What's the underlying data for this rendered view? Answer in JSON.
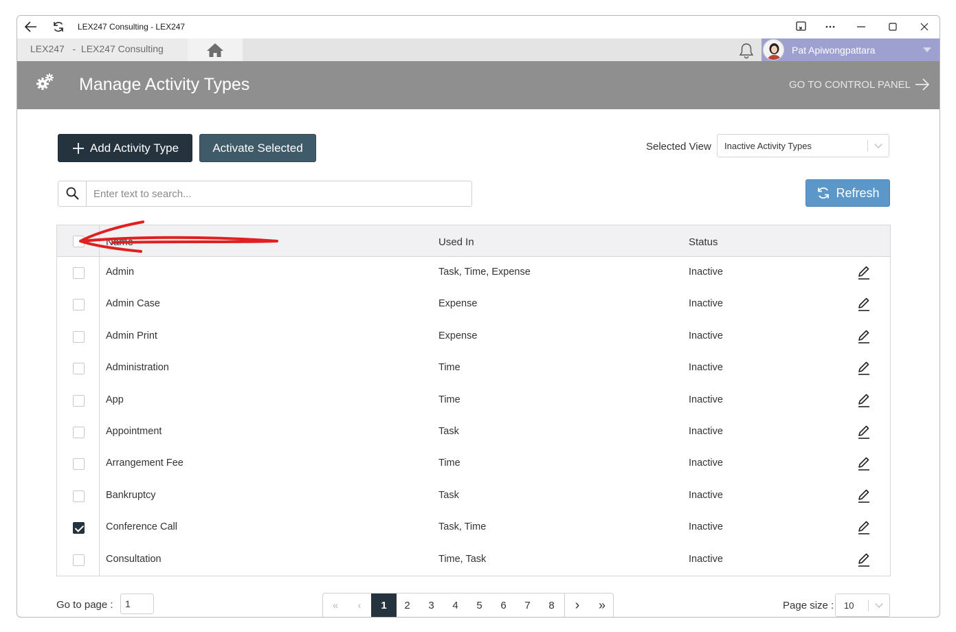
{
  "window": {
    "title": "LEX247 Consulting - LEX247"
  },
  "tabs": {
    "main_label": "LEX247   -  LEX247 Consulting",
    "home_icon": "home-icon"
  },
  "user": {
    "name": "Pat Apiwongpattara"
  },
  "header": {
    "title": "Manage Activity Types",
    "control_panel_label": "GO TO CONTROL PANEL"
  },
  "toolbar": {
    "add_label": "Add Activity Type",
    "activate_label": "Activate Selected",
    "selected_view_label": "Selected View",
    "selected_view_value": "Inactive Activity Types",
    "refresh_label": "Refresh"
  },
  "search": {
    "placeholder": "Enter text to search..."
  },
  "grid": {
    "columns": [
      "Name",
      "Used In",
      "Status"
    ],
    "rows": [
      {
        "name": "Admin",
        "used_in": "Task, Time, Expense",
        "status": "Inactive",
        "checked": false
      },
      {
        "name": "Admin Case",
        "used_in": "Expense",
        "status": "Inactive",
        "checked": false
      },
      {
        "name": "Admin Print",
        "used_in": "Expense",
        "status": "Inactive",
        "checked": false
      },
      {
        "name": "Administration",
        "used_in": "Time",
        "status": "Inactive",
        "checked": false
      },
      {
        "name": "App",
        "used_in": "Time",
        "status": "Inactive",
        "checked": false
      },
      {
        "name": "Appointment",
        "used_in": "Task",
        "status": "Inactive",
        "checked": false
      },
      {
        "name": "Arrangement Fee",
        "used_in": "Time",
        "status": "Inactive",
        "checked": false
      },
      {
        "name": "Bankruptcy",
        "used_in": "Task",
        "status": "Inactive",
        "checked": false
      },
      {
        "name": "Conference Call",
        "used_in": "Task, Time",
        "status": "Inactive",
        "checked": true
      },
      {
        "name": "Consultation",
        "used_in": "Time, Task",
        "status": "Inactive",
        "checked": false
      }
    ]
  },
  "footer": {
    "goto_label": "Go to page :",
    "goto_value": "1",
    "pages": [
      "1",
      "2",
      "3",
      "4",
      "5",
      "6",
      "7",
      "8"
    ],
    "current_page": "1",
    "page_size_label": "Page size :",
    "page_size_value": "10"
  },
  "colors": {
    "dark": "#25333f",
    "header": "#8f8f8f",
    "refresh": "#5b98c9",
    "user": "#9ea1cf",
    "annotation": "#e02020"
  }
}
